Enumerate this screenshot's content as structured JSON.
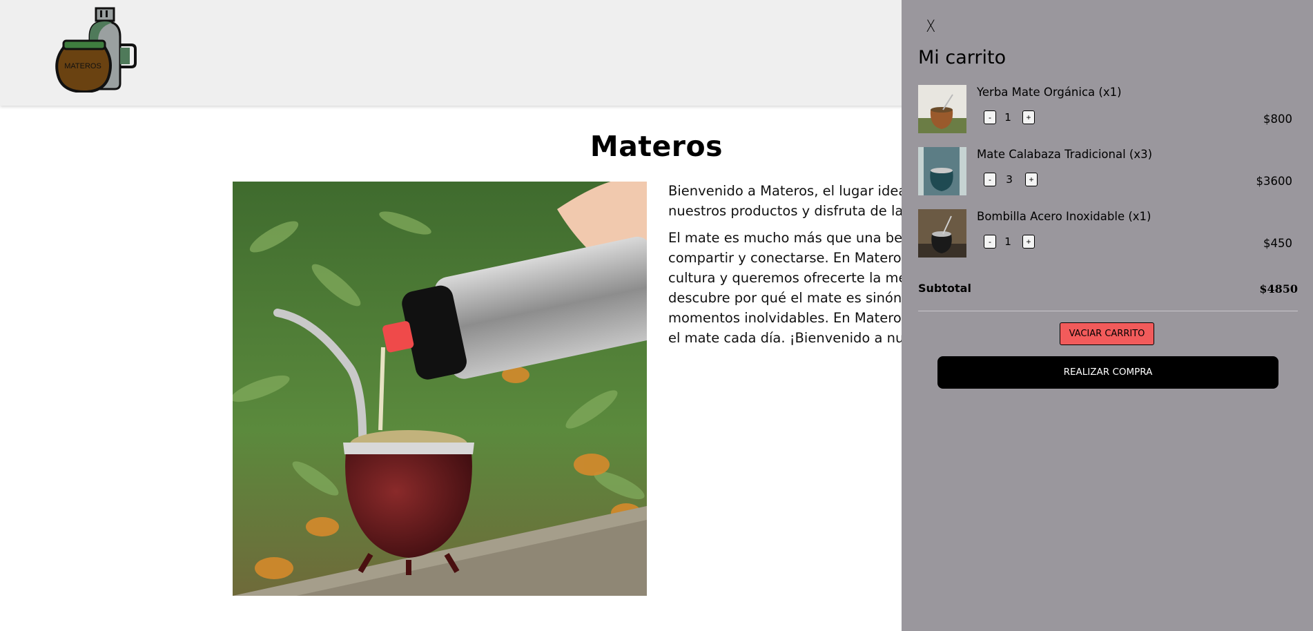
{
  "header": {
    "logo_text": "MATEROS"
  },
  "main": {
    "title": "Materos",
    "paragraphs": [
      "Bienvenido a Materos, el lugar idea",
      "nuestros productos y disfruta de la",
      "El mate es mucho más que una be",
      "compartir y conectarse. En Materos",
      "cultura y queremos ofrecerte la me",
      "descubre por qué el mate es sinóni",
      "momentos inolvidables. En Materos",
      "el mate cada día. ¡Bienvenido a nu"
    ]
  },
  "cart": {
    "close_label": "X",
    "title": "Mi carrito",
    "items": [
      {
        "name": "Yerba Mate Orgánica (x1)",
        "quantity": "1",
        "price": "$800",
        "decrease_label": "-",
        "increase_label": "+"
      },
      {
        "name": "Mate Calabaza Tradicional (x3)",
        "quantity": "3",
        "price": "$3600",
        "decrease_label": "-",
        "increase_label": "+"
      },
      {
        "name": "Bombilla Acero Inoxidable (x1)",
        "quantity": "1",
        "price": "$450",
        "decrease_label": "-",
        "increase_label": "+"
      }
    ],
    "subtotal_label": "Subtotal",
    "subtotal_value": "$4850",
    "empty_button": "VACIAR CARRITO",
    "checkout_button": "REALIZAR COMPRA"
  },
  "colors": {
    "header_bg": "#efefef",
    "cart_panel_bg": "#9a979d",
    "empty_button_bg": "#f25b5b",
    "checkout_button_bg": "#000000"
  }
}
